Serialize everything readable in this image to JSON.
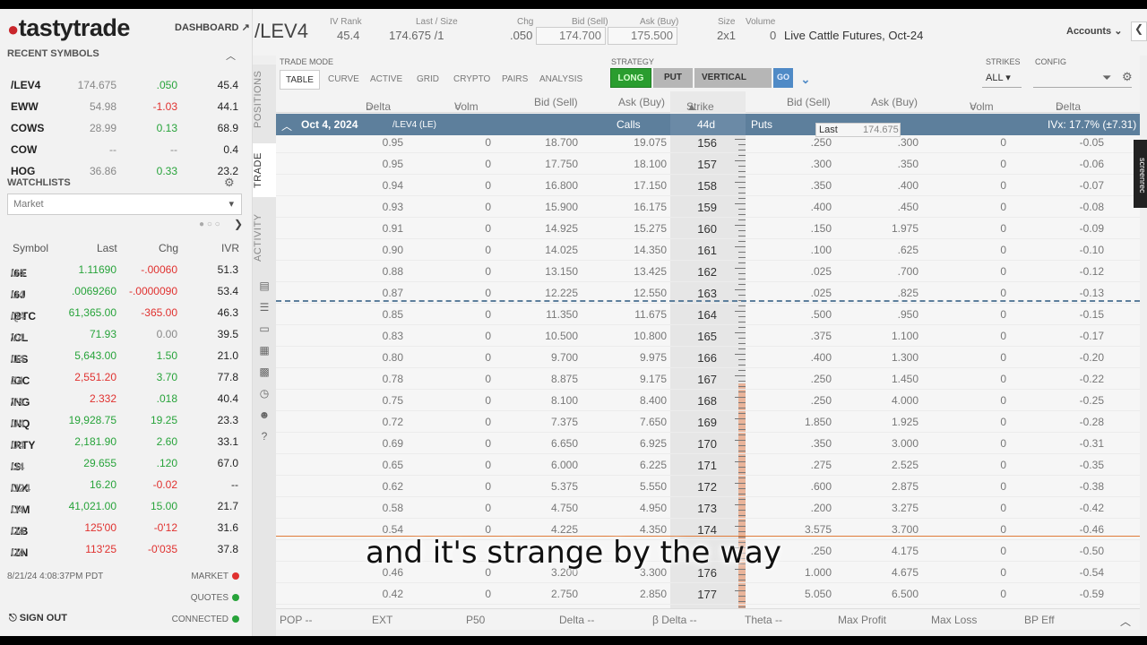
{
  "app": {
    "logo": "tastytrade",
    "dashboard": "DASHBOARD"
  },
  "recent": {
    "title": "RECENT SYMBOLS",
    "rows": [
      {
        "sym": "/LEV4",
        "last": "174.675",
        "chg": ".050",
        "ivr": "45.4",
        "chg_color": "green"
      },
      {
        "sym": "EWW",
        "last": "54.98",
        "chg": "-1.03",
        "ivr": "44.1",
        "chg_color": "red"
      },
      {
        "sym": "COWS",
        "last": "28.99",
        "chg": "0.13",
        "ivr": "68.9",
        "chg_color": "green"
      },
      {
        "sym": "COW",
        "last": "--",
        "chg": "--",
        "ivr": "0.4",
        "chg_color": "grey"
      },
      {
        "sym": "HOG",
        "last": "36.86",
        "chg": "0.33",
        "ivr": "23.2",
        "chg_color": "green"
      }
    ]
  },
  "watchlists": {
    "title": "WATCHLISTS",
    "selected": "Market",
    "headers": {
      "symbol": "Symbol",
      "last": "Last",
      "chg": "Chg",
      "ivr": "IVR"
    },
    "rows": [
      {
        "a": "/6E",
        "b": "U4",
        "last": "1.11690",
        "chg": "-.00060",
        "ivr": "51.3",
        "lc": "green",
        "cc": "red"
      },
      {
        "a": "/6J",
        "b": "U4",
        "last": ".0069260",
        "chg": "-.0000090",
        "ivr": "53.4",
        "lc": "green",
        "cc": "red"
      },
      {
        "a": "/BTC",
        "b": "Q4",
        "last": "61,365.00",
        "chg": "-365.00",
        "ivr": "46.3",
        "lc": "green",
        "cc": "red"
      },
      {
        "a": "/CL",
        "b": "V4",
        "last": "71.93",
        "chg": "0.00",
        "ivr": "39.5",
        "lc": "green",
        "cc": "grey"
      },
      {
        "a": "/ES",
        "b": "U4",
        "last": "5,643.00",
        "chg": "1.50",
        "ivr": "21.0",
        "lc": "green",
        "cc": "green"
      },
      {
        "a": "/GC",
        "b": "Z4",
        "last": "2,551.20",
        "chg": "3.70",
        "ivr": "77.8",
        "lc": "red",
        "cc": "green"
      },
      {
        "a": "/NG",
        "b": "V4",
        "last": "2.332",
        "chg": ".018",
        "ivr": "40.4",
        "lc": "red",
        "cc": "green"
      },
      {
        "a": "/NQ",
        "b": "U4",
        "last": "19,928.75",
        "chg": "19.25",
        "ivr": "23.3",
        "lc": "green",
        "cc": "green"
      },
      {
        "a": "/RTY",
        "b": "U4",
        "last": "2,181.90",
        "chg": "2.60",
        "ivr": "33.1",
        "lc": "green",
        "cc": "green"
      },
      {
        "a": "/SI",
        "b": "U4",
        "last": "29.655",
        "chg": ".120",
        "ivr": "67.0",
        "lc": "green",
        "cc": "green"
      },
      {
        "a": "/VX",
        "b": "U24",
        "last": "16.20",
        "chg": "-0.02",
        "ivr": "--",
        "lc": "green",
        "cc": "red"
      },
      {
        "a": "/YM",
        "b": "U4",
        "last": "41,021.00",
        "chg": "15.00",
        "ivr": "21.7",
        "lc": "green",
        "cc": "green"
      },
      {
        "a": "/ZB",
        "b": "U4",
        "last": "125'00",
        "chg": "-0'12",
        "ivr": "31.6",
        "lc": "red",
        "cc": "red"
      },
      {
        "a": "/ZN",
        "b": "U4",
        "last": "113'25",
        "chg": "-0'035",
        "ivr": "37.8",
        "lc": "red",
        "cc": "red"
      }
    ]
  },
  "status": {
    "timestamp": "8/21/24 4:08:37PM PDT",
    "market": "MARKET",
    "quotes": "QUOTES",
    "connected": "CONNECTED",
    "signout": "SIGN OUT"
  },
  "header": {
    "symbol": "/LEV4",
    "ivrank_label": "IV Rank",
    "ivrank": "45.4",
    "lastsize_label": "Last / Size",
    "lastsize": "174.675 /1",
    "chg_label": "Chg",
    "chg": ".050",
    "bid_label": "Bid (Sell)",
    "bid": "174.700",
    "ask_label": "Ask (Buy)",
    "ask": "175.500",
    "size_label": "Size",
    "size": "2x1",
    "volume_label": "Volume",
    "volume": "0",
    "description": "Live Cattle Futures, Oct-24",
    "accounts": "Accounts"
  },
  "vtabs": {
    "positions": "POSITIONS",
    "trade": "TRADE",
    "activity": "ACTIVITY"
  },
  "toolbar": {
    "trade_mode_label": "TRADE MODE",
    "modes": [
      "TABLE",
      "CURVE",
      "ACTIVE",
      "GRID",
      "CRYPTO",
      "PAIRS",
      "ANALYSIS"
    ],
    "strategy_label": "STRATEGY",
    "long": "LONG",
    "put": "PUT",
    "vertical": "VERTICAL",
    "go": "GO",
    "strikes_label": "STRIKES",
    "strikes_value": "ALL",
    "config_label": "CONFIG"
  },
  "columns": {
    "call_delta": "Delta",
    "call_volm": "Volm",
    "call_bid": "Bid (Sell)",
    "call_ask": "Ask (Buy)",
    "strike": "Strike",
    "put_bid": "Bid (Sell)",
    "put_ask": "Ask (Buy)",
    "put_volm": "Volm",
    "put_delta": "Delta"
  },
  "expiration": {
    "date": "Oct 4, 2024",
    "root": "/LEV4 (LE)",
    "calls": "Calls",
    "dte": "44d",
    "puts": "Puts",
    "ivx": "IVx: 17.7% (±7.31)"
  },
  "tooltip": {
    "label": "Last",
    "value": "174.675"
  },
  "chain": [
    {
      "cd": "0.95",
      "cv": "0",
      "cb": "18.700",
      "ca": "19.075",
      "k": "156",
      "pb": ".250",
      "pa": ".300",
      "pv": "0",
      "pd": "-0.05"
    },
    {
      "cd": "0.95",
      "cv": "0",
      "cb": "17.750",
      "ca": "18.100",
      "k": "157",
      "pb": ".300",
      "pa": ".350",
      "pv": "0",
      "pd": "-0.06"
    },
    {
      "cd": "0.94",
      "cv": "0",
      "cb": "16.800",
      "ca": "17.150",
      "k": "158",
      "pb": ".350",
      "pa": ".400",
      "pv": "0",
      "pd": "-0.07"
    },
    {
      "cd": "0.93",
      "cv": "0",
      "cb": "15.900",
      "ca": "16.175",
      "k": "159",
      "pb": ".400",
      "pa": ".450",
      "pv": "0",
      "pd": "-0.08"
    },
    {
      "cd": "0.91",
      "cv": "0",
      "cb": "14.925",
      "ca": "15.275",
      "k": "160",
      "pb": ".150",
      "pa": "1.975",
      "pv": "0",
      "pd": "-0.09"
    },
    {
      "cd": "0.90",
      "cv": "0",
      "cb": "14.025",
      "ca": "14.350",
      "k": "161",
      "pb": ".100",
      "pa": ".625",
      "pv": "0",
      "pd": "-0.10"
    },
    {
      "cd": "0.88",
      "cv": "0",
      "cb": "13.150",
      "ca": "13.425",
      "k": "162",
      "pb": ".025",
      "pa": ".700",
      "pv": "0",
      "pd": "-0.12"
    },
    {
      "cd": "0.87",
      "cv": "0",
      "cb": "12.225",
      "ca": "12.550",
      "k": "163",
      "pb": ".025",
      "pa": ".825",
      "pv": "0",
      "pd": "-0.13"
    },
    {
      "cd": "0.85",
      "cv": "0",
      "cb": "11.350",
      "ca": "11.675",
      "k": "164",
      "pb": ".500",
      "pa": ".950",
      "pv": "0",
      "pd": "-0.15"
    },
    {
      "cd": "0.83",
      "cv": "0",
      "cb": "10.500",
      "ca": "10.800",
      "k": "165",
      "pb": ".375",
      "pa": "1.100",
      "pv": "0",
      "pd": "-0.17"
    },
    {
      "cd": "0.80",
      "cv": "0",
      "cb": "9.700",
      "ca": "9.975",
      "k": "166",
      "pb": ".400",
      "pa": "1.300",
      "pv": "0",
      "pd": "-0.20"
    },
    {
      "cd": "0.78",
      "cv": "0",
      "cb": "8.875",
      "ca": "9.175",
      "k": "167",
      "pb": ".250",
      "pa": "1.450",
      "pv": "0",
      "pd": "-0.22"
    },
    {
      "cd": "0.75",
      "cv": "0",
      "cb": "8.100",
      "ca": "8.400",
      "k": "168",
      "pb": ".250",
      "pa": "4.000",
      "pv": "0",
      "pd": "-0.25"
    },
    {
      "cd": "0.72",
      "cv": "0",
      "cb": "7.375",
      "ca": "7.650",
      "k": "169",
      "pb": "1.850",
      "pa": "1.925",
      "pv": "0",
      "pd": "-0.28"
    },
    {
      "cd": "0.69",
      "cv": "0",
      "cb": "6.650",
      "ca": "6.925",
      "k": "170",
      "pb": ".350",
      "pa": "3.000",
      "pv": "0",
      "pd": "-0.31"
    },
    {
      "cd": "0.65",
      "cv": "0",
      "cb": "6.000",
      "ca": "6.225",
      "k": "171",
      "pb": ".275",
      "pa": "2.525",
      "pv": "0",
      "pd": "-0.35"
    },
    {
      "cd": "0.62",
      "cv": "0",
      "cb": "5.375",
      "ca": "5.550",
      "k": "172",
      "pb": ".600",
      "pa": "2.875",
      "pv": "0",
      "pd": "-0.38"
    },
    {
      "cd": "0.58",
      "cv": "0",
      "cb": "4.750",
      "ca": "4.950",
      "k": "173",
      "pb": ".200",
      "pa": "3.275",
      "pv": "0",
      "pd": "-0.42"
    },
    {
      "cd": "0.54",
      "cv": "0",
      "cb": "4.225",
      "ca": "4.350",
      "k": "174",
      "pb": "3.575",
      "pa": "3.700",
      "pv": "0",
      "pd": "-0.46"
    },
    {
      "cd": "",
      "cv": "",
      "cb": "",
      "ca": "",
      "k": "",
      "pb": ".250",
      "pa": "4.175",
      "pv": "0",
      "pd": "-0.50"
    },
    {
      "cd": "0.46",
      "cv": "0",
      "cb": "3.200",
      "ca": "3.300",
      "k": "176",
      "pb": "1.000",
      "pa": "4.675",
      "pv": "0",
      "pd": "-0.54"
    },
    {
      "cd": "0.42",
      "cv": "0",
      "cb": "2.750",
      "ca": "2.850",
      "k": "177",
      "pb": "5.050",
      "pa": "6.500",
      "pv": "0",
      "pd": "-0.59"
    }
  ],
  "footer": {
    "pop": "POP --",
    "ext": "EXT",
    "p50": "P50",
    "delta": "Delta --",
    "bdelta": "β Delta --",
    "theta": "Theta --",
    "maxprofit": "Max Profit",
    "maxloss": "Max Loss",
    "bpeff": "BP Eff"
  },
  "caption": "and it's strange by the way",
  "screenrec": "screenrec",
  "colors": {
    "green": "#27a33a",
    "red": "#e0312f",
    "header_blue": "#5d7f9c",
    "go_blue": "#4f8ac6",
    "long_green": "#2a9d2f",
    "ruler_orange": "#e9b49a"
  }
}
